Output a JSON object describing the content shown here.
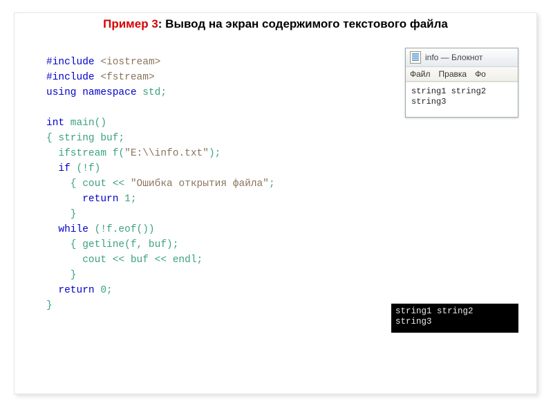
{
  "title": {
    "prefix": "Пример 3",
    "rest": ": Вывод на экран содержимого текстового файла"
  },
  "code": {
    "l1a": "#include",
    "l1b": " <iostream>",
    "l2a": "#include",
    "l2b": " <fstream>",
    "l3a": "using",
    "l3b": " namespace",
    "l3c": " std;",
    "blank1": " ",
    "l4a": "int",
    "l4b": " main()",
    "l5a": "{ ",
    "l5b": "string buf;",
    "l6a": "  ifstream f(",
    "l6b": "\"E:\\\\info.txt\"",
    "l6c": ");",
    "l7a": "  ",
    "l7b": "if",
    "l7c": " (!f)",
    "l8a": "    { cout << ",
    "l8b": "\"Ошибка открытия файла\"",
    "l8c": ";",
    "l9a": "      ",
    "l9b": "return",
    "l9c": " 1;",
    "l10": "    }",
    "l11a": "  ",
    "l11b": "while",
    "l11c": " (!f.eof())",
    "l12": "    { getline(f, buf);",
    "l13": "      cout << buf << endl;",
    "l14": "    }",
    "l15a": "  ",
    "l15b": "return",
    "l15c": " 0;",
    "l16": "}"
  },
  "notepad": {
    "title": "info — Блокнот",
    "menu": {
      "file": "Файл",
      "edit": "Правка",
      "format": "Фо"
    },
    "body_line1": "string1 string2",
    "body_line2": "string3"
  },
  "console": {
    "line1": "string1 string2",
    "line2": "string3"
  }
}
